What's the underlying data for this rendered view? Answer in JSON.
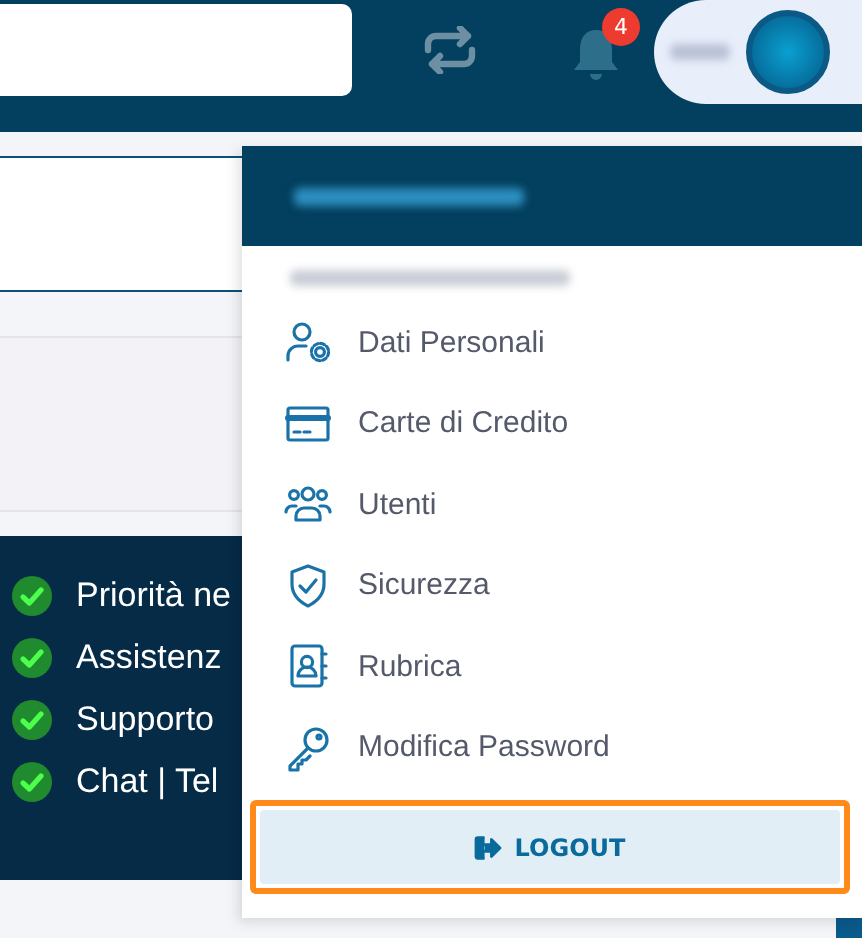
{
  "top_bar": {
    "notification_count": "4"
  },
  "features": [
    {
      "label": "Priorità ne"
    },
    {
      "label": "Assistenz"
    },
    {
      "label": "Supporto"
    },
    {
      "label": "Chat | Tel"
    }
  ],
  "user_menu": {
    "expanded": true,
    "items": [
      {
        "kind": "profile",
        "label": "Dati Personali"
      },
      {
        "kind": "card",
        "label": "Carte di Credito"
      },
      {
        "kind": "users",
        "label": "Utenti"
      },
      {
        "kind": "shield",
        "label": "Sicurezza"
      },
      {
        "kind": "contacts",
        "label": "Rubrica"
      },
      {
        "kind": "key",
        "label": "Modifica Password"
      }
    ],
    "logout": "LOGOUT"
  }
}
